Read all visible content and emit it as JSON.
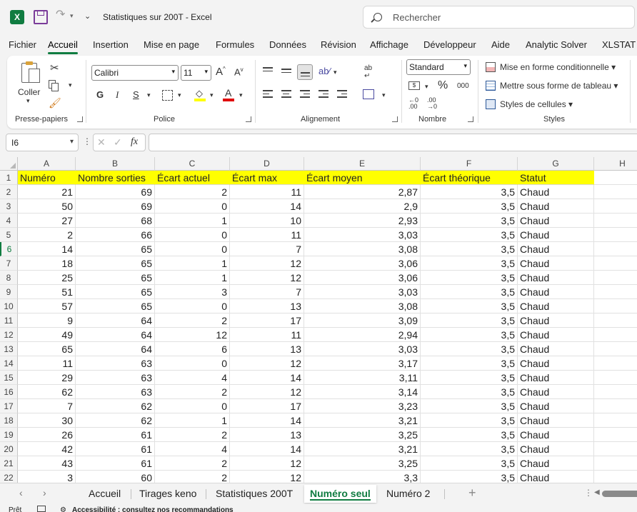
{
  "window": {
    "title": "Statistiques sur 200T  -  Excel"
  },
  "search": {
    "placeholder": "Rechercher"
  },
  "menu": {
    "tabs": [
      "Fichier",
      "Accueil",
      "Insertion",
      "Mise en page",
      "Formules",
      "Données",
      "Révision",
      "Affichage",
      "Développeur",
      "Aide",
      "Analytic Solver",
      "XLSTAT C"
    ],
    "active": "Accueil"
  },
  "ribbon": {
    "clipboard": {
      "paste_label": "Coller",
      "group_label": "Presse-papiers"
    },
    "font": {
      "family": "Calibri",
      "size": "11",
      "bold": "G",
      "italic": "I",
      "underline": "S",
      "group_label": "Police"
    },
    "alignment": {
      "group_label": "Alignement"
    },
    "number": {
      "format": "Standard",
      "percent": "%",
      "thousands": "000",
      "group_label": "Nombre"
    },
    "styles": {
      "conditional": "Mise en forme conditionnelle",
      "as_table": "Mettre sous forme de tableau",
      "cell_styles": "Styles de cellules",
      "group_label": "Styles"
    }
  },
  "formula_bar": {
    "name_box": "I6",
    "fx": "fx",
    "value": ""
  },
  "sheet": {
    "columns": [
      "A",
      "B",
      "C",
      "D",
      "E",
      "F",
      "G",
      "H"
    ],
    "header_row": [
      "Numéro",
      "Nombre sorties",
      "Écart actuel",
      "Écart max",
      "Écart moyen",
      "Écart théorique",
      "Statut"
    ],
    "rows": [
      [
        "21",
        "69",
        "2",
        "11",
        "2,87",
        "3,5",
        "Chaud"
      ],
      [
        "50",
        "69",
        "0",
        "14",
        "2,9",
        "3,5",
        "Chaud"
      ],
      [
        "27",
        "68",
        "1",
        "10",
        "2,93",
        "3,5",
        "Chaud"
      ],
      [
        "2",
        "66",
        "0",
        "11",
        "3,03",
        "3,5",
        "Chaud"
      ],
      [
        "14",
        "65",
        "0",
        "7",
        "3,08",
        "3,5",
        "Chaud"
      ],
      [
        "18",
        "65",
        "1",
        "12",
        "3,06",
        "3,5",
        "Chaud"
      ],
      [
        "25",
        "65",
        "1",
        "12",
        "3,06",
        "3,5",
        "Chaud"
      ],
      [
        "51",
        "65",
        "3",
        "7",
        "3,03",
        "3,5",
        "Chaud"
      ],
      [
        "57",
        "65",
        "0",
        "13",
        "3,08",
        "3,5",
        "Chaud"
      ],
      [
        "9",
        "64",
        "2",
        "17",
        "3,09",
        "3,5",
        "Chaud"
      ],
      [
        "49",
        "64",
        "12",
        "11",
        "2,94",
        "3,5",
        "Chaud"
      ],
      [
        "65",
        "64",
        "6",
        "13",
        "3,03",
        "3,5",
        "Chaud"
      ],
      [
        "11",
        "63",
        "0",
        "12",
        "3,17",
        "3,5",
        "Chaud"
      ],
      [
        "29",
        "63",
        "4",
        "14",
        "3,11",
        "3,5",
        "Chaud"
      ],
      [
        "62",
        "63",
        "2",
        "12",
        "3,14",
        "3,5",
        "Chaud"
      ],
      [
        "7",
        "62",
        "0",
        "17",
        "3,23",
        "3,5",
        "Chaud"
      ],
      [
        "30",
        "62",
        "1",
        "14",
        "3,21",
        "3,5",
        "Chaud"
      ],
      [
        "26",
        "61",
        "2",
        "13",
        "3,25",
        "3,5",
        "Chaud"
      ],
      [
        "42",
        "61",
        "4",
        "14",
        "3,21",
        "3,5",
        "Chaud"
      ],
      [
        "43",
        "61",
        "2",
        "12",
        "3,25",
        "3,5",
        "Chaud"
      ],
      [
        "3",
        "60",
        "2",
        "12",
        "3,3",
        "3,5",
        "Chaud"
      ]
    ],
    "selected_row": 6,
    "header_fill": "#ffff00"
  },
  "sheet_tabs": {
    "tabs": [
      "Accueil",
      "Tirages keno",
      "Statistiques 200T",
      "Numéro seul",
      "Numéro 2"
    ],
    "active": "Numéro seul"
  },
  "status": {
    "ready": "Prêt",
    "accessibility": "Accessibilité : consultez nos recommandations"
  },
  "accent": "#107c41"
}
